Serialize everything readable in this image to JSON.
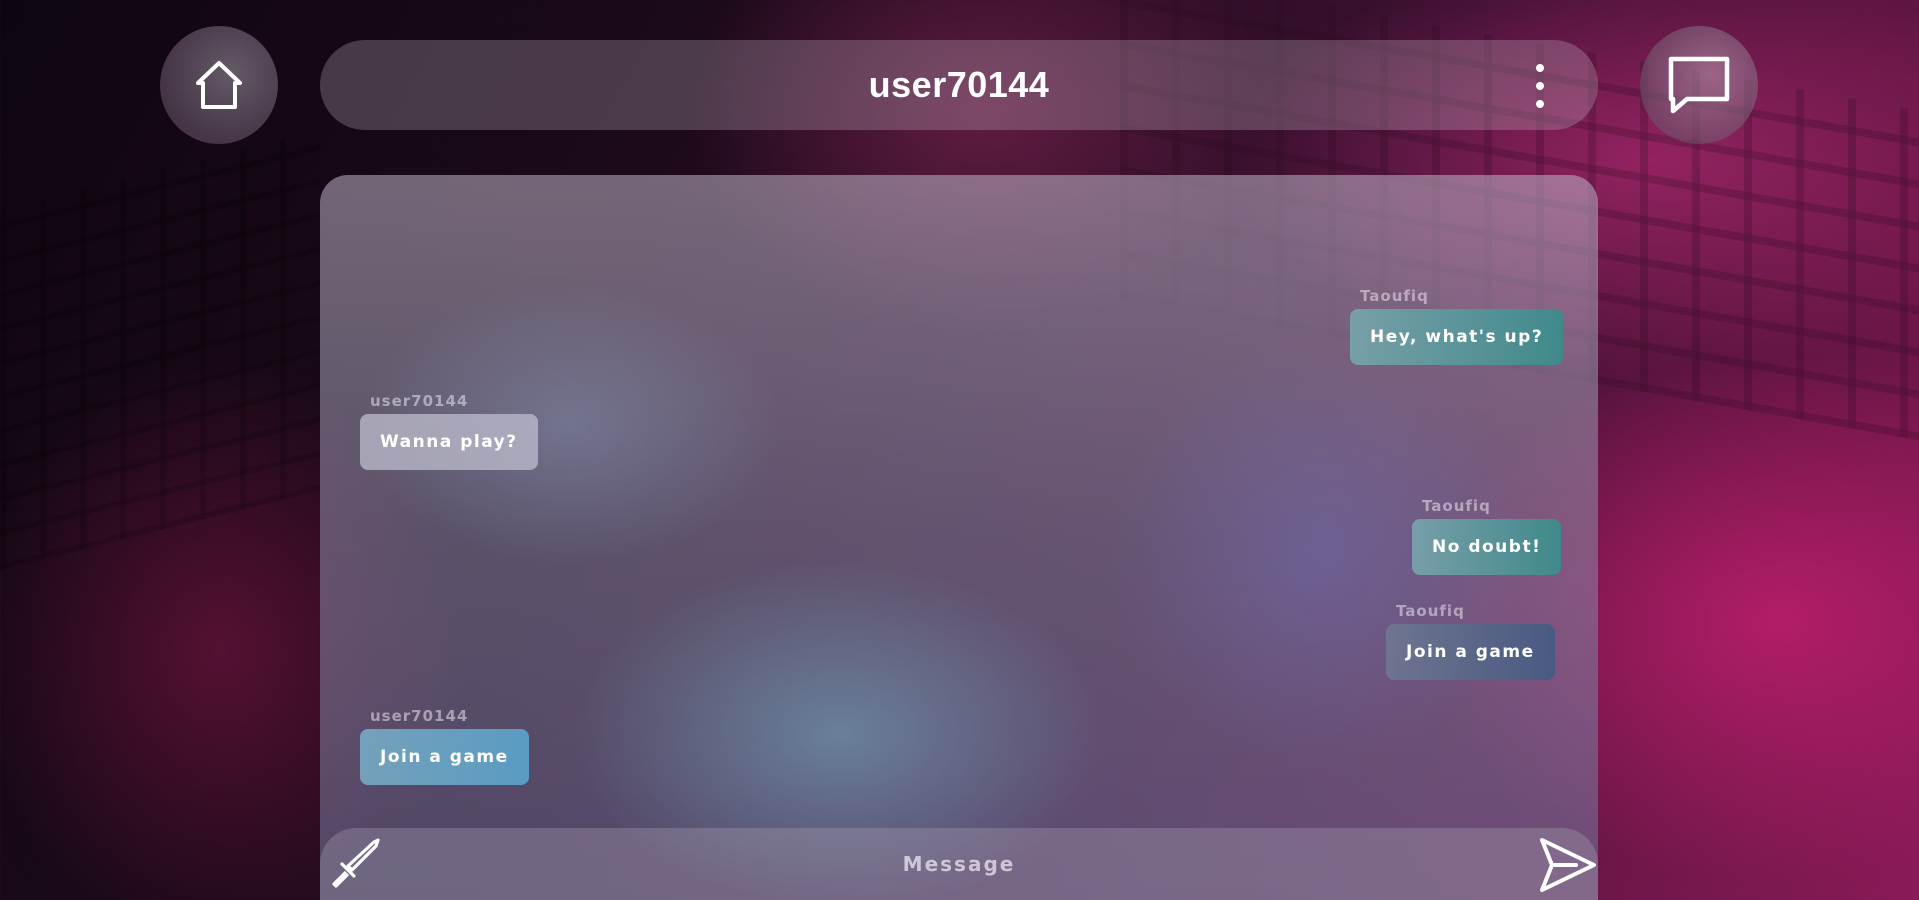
{
  "header": {
    "title": "user70144",
    "home_icon": "home-icon",
    "chat_icon": "chat-bubble-icon",
    "more_icon": "more-vertical-icon"
  },
  "messages": [
    {
      "sender": "Taoufiq",
      "text": "Hey, what's up?",
      "side": "right",
      "style": "teal"
    },
    {
      "sender": "user70144",
      "text": "Wanna play?",
      "side": "left",
      "style": "grey"
    },
    {
      "sender": "Taoufiq",
      "text": "No doubt!",
      "side": "right",
      "style": "teal"
    },
    {
      "sender": "Taoufiq",
      "text": "Join a game",
      "side": "right",
      "style": "slate"
    },
    {
      "sender": "user70144",
      "text": "Join a game",
      "side": "left",
      "style": "blue"
    }
  ],
  "composer": {
    "placeholder": "Message",
    "value": "",
    "left_icon": "sword-icon",
    "send_icon": "send-icon"
  }
}
